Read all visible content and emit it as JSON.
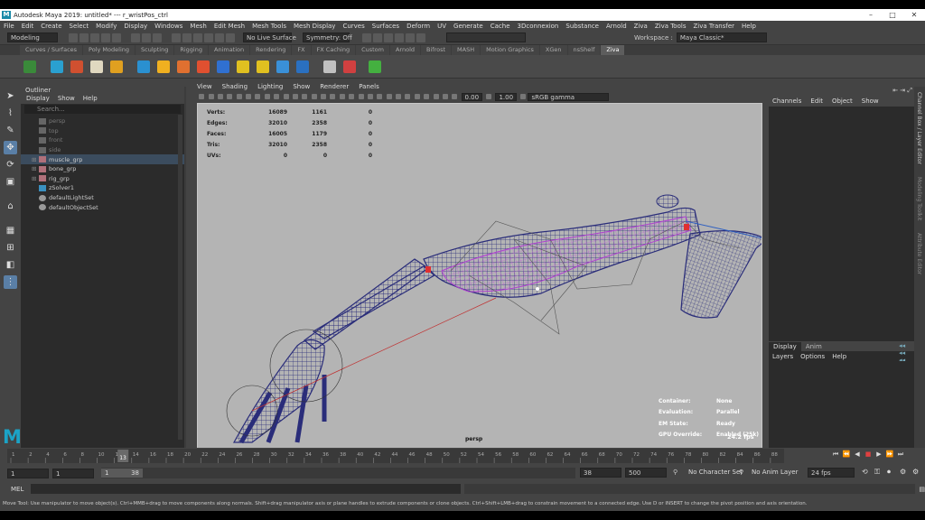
{
  "window": {
    "title": "Autodesk Maya 2019: untitled*   ---   r_wristPos_ctrl",
    "logo": "M",
    "min": "–",
    "max": "□",
    "close": "✕"
  },
  "menubar": [
    "File",
    "Edit",
    "Create",
    "Select",
    "Modify",
    "Display",
    "Windows",
    "Mesh",
    "Edit Mesh",
    "Mesh Tools",
    "Mesh Display",
    "Curves",
    "Surfaces",
    "Deform",
    "UV",
    "Generate",
    "Cache",
    "3Dconnexion",
    "Substance",
    "Arnold",
    "Ziva",
    "Ziva Tools",
    "Ziva Transfer",
    "Help"
  ],
  "status": {
    "menuset": "Modeling",
    "live_surface": "No Live Surface",
    "symmetry": "Symmetry: Off",
    "workspace_label": "Workspace :",
    "workspace": "Maya Classic*"
  },
  "shelf_tabs": [
    "Curves / Surfaces",
    "Poly Modeling",
    "Sculpting",
    "Rigging",
    "Animation",
    "Rendering",
    "FX",
    "FX Caching",
    "Custom",
    "Arnold",
    "Bifrost",
    "MASH",
    "Motion Graphics",
    "XGen",
    "nsShelf",
    "Ziva"
  ],
  "shelf_active": "Ziva",
  "outliner": {
    "title": "Outliner",
    "menu": [
      "Display",
      "Show",
      "Help"
    ],
    "search_placeholder": "Search...",
    "items": [
      {
        "label": "persp"
      },
      {
        "label": "top"
      },
      {
        "label": "front"
      },
      {
        "label": "side"
      },
      {
        "label": "muscle_grp"
      },
      {
        "label": "bone_grp"
      },
      {
        "label": "rig_grp"
      },
      {
        "label": "zSolver1"
      },
      {
        "label": "defaultLightSet"
      },
      {
        "label": "defaultObjectSet"
      }
    ]
  },
  "viewport": {
    "menu": [
      "View",
      "Shading",
      "Lighting",
      "Show",
      "Renderer",
      "Panels"
    ],
    "exposure": "0.00",
    "gamma": "1.00",
    "colorspace": "sRGB gamma",
    "hud": [
      {
        "label": "Verts:",
        "a": "16089",
        "b": "1161",
        "c": "0"
      },
      {
        "label": "Edges:",
        "a": "32010",
        "b": "2358",
        "c": "0"
      },
      {
        "label": "Faces:",
        "a": "16005",
        "b": "1179",
        "c": "0"
      },
      {
        "label": "Tris:",
        "a": "32010",
        "b": "2358",
        "c": "0"
      },
      {
        "label": "UVs:",
        "a": "0",
        "b": "0",
        "c": "0"
      }
    ],
    "hud2": [
      {
        "label": "Container:",
        "value": "None"
      },
      {
        "label": "Evaluation:",
        "value": "Parallel"
      },
      {
        "label": "EM State:",
        "value": "Ready"
      },
      {
        "label": "GPU Override:",
        "value": "Enabled (25k)"
      }
    ],
    "fps": "24.2 fps",
    "camera": "persp"
  },
  "channelbox": {
    "menu": [
      "Channels",
      "Edit",
      "Object",
      "Show"
    ]
  },
  "layers": {
    "tabs": [
      "Display",
      "Anim"
    ],
    "menu": [
      "Layers",
      "Options",
      "Help"
    ]
  },
  "side_tabs": [
    "Channel Box / Layer Editor",
    "Modeling Toolkit",
    "Attribute Editor"
  ],
  "timeline": {
    "ticks": [
      "1",
      "2",
      "4",
      "6",
      "8",
      "10",
      "12",
      "14",
      "16",
      "18",
      "20",
      "22",
      "24",
      "26",
      "28",
      "30",
      "32",
      "34",
      "36",
      "38",
      "40",
      "42",
      "44",
      "46",
      "48",
      "50",
      "52",
      "54",
      "56",
      "58",
      "60",
      "62",
      "64",
      "66",
      "68",
      "70",
      "72",
      "74",
      "76",
      "78",
      "80",
      "82",
      "84",
      "86",
      "88"
    ],
    "current": "13",
    "play_buttons": [
      "⏮",
      "⏪",
      "◀",
      "■",
      "▶",
      "⏩",
      "⏭"
    ]
  },
  "range": {
    "start": "1",
    "inner_start": "1",
    "slider_start": "1",
    "slider_end": "38",
    "end_a": "38",
    "end_b": "500",
    "character_set": "No Character Set",
    "anim_layer": "No Anim Layer",
    "fps": "24 fps"
  },
  "mel": {
    "label": "MEL"
  },
  "help": "Move Tool: Use manipulator to move object(s). Ctrl+MMB+drag to move components along normals. Shift+drag manipulator axis or plane handles to extrude components or clone objects. Ctrl+Shift+LMB+drag to constrain movement to a connected edge. Use D or INSERT to change the pivot position and axis orientation.",
  "colors": {
    "accent": "#5a7fa6",
    "viewport_bg": "#b4b4b4",
    "wire": "#2a2d7a",
    "selected_wire": "#c050e0",
    "maya_logo": "#1ba3c6"
  }
}
